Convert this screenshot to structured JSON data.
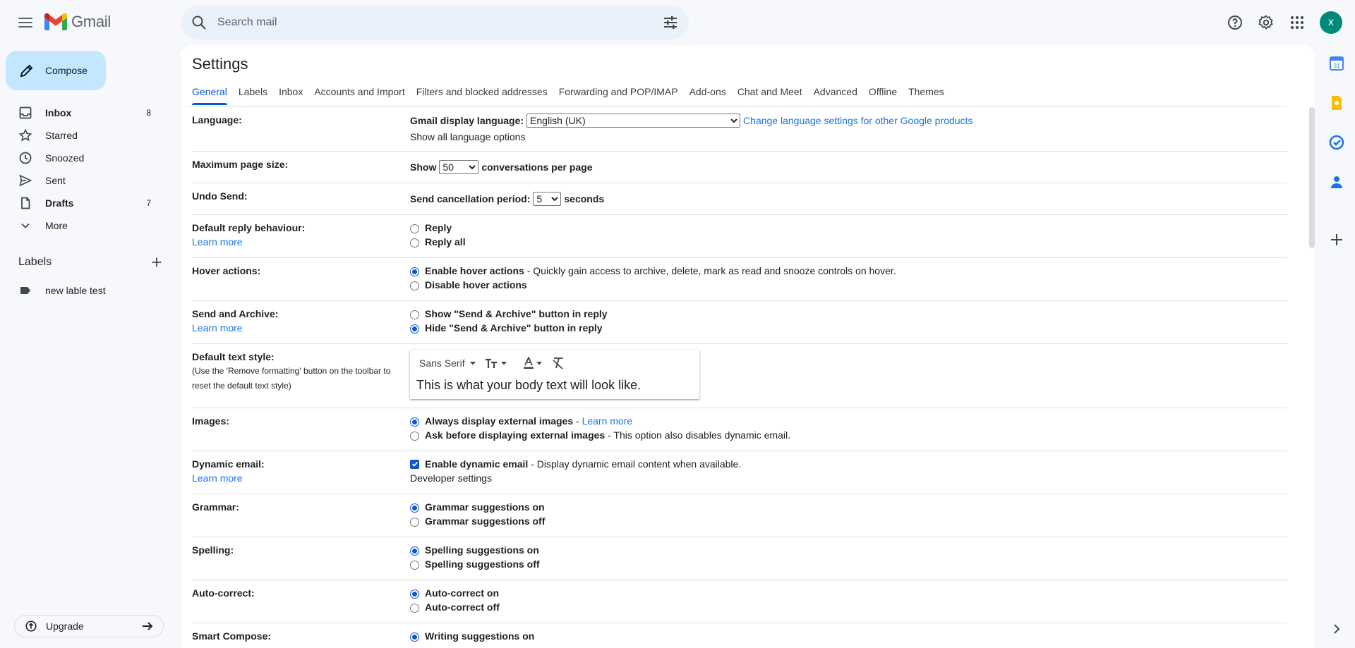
{
  "app": {
    "name": "Gmail"
  },
  "search": {
    "placeholder": "Search mail"
  },
  "user": {
    "initial": "x"
  },
  "compose_label": "Compose",
  "nav": [
    {
      "label": "Inbox",
      "count": "8",
      "bold": true,
      "icon": "inbox-icon"
    },
    {
      "label": "Starred",
      "count": "",
      "bold": false,
      "icon": "star-icon"
    },
    {
      "label": "Snoozed",
      "count": "",
      "bold": false,
      "icon": "clock-icon"
    },
    {
      "label": "Sent",
      "count": "",
      "bold": false,
      "icon": "send-icon"
    },
    {
      "label": "Drafts",
      "count": "7",
      "bold": true,
      "icon": "draft-icon"
    },
    {
      "label": "More",
      "count": "",
      "bold": false,
      "icon": "chevron-down-icon"
    }
  ],
  "labels": {
    "heading": "Labels",
    "items": [
      "new lable test"
    ]
  },
  "upgrade_label": "Upgrade",
  "settings": {
    "title": "Settings",
    "tabs": [
      "General",
      "Labels",
      "Inbox",
      "Accounts and Import",
      "Filters and blocked addresses",
      "Forwarding and POP/IMAP",
      "Add-ons",
      "Chat and Meet",
      "Advanced",
      "Offline",
      "Themes"
    ],
    "active_tab": "General",
    "language": {
      "label": "Language:",
      "display_label": "Gmail display language:",
      "selected": "English (UK)",
      "change_link": "Change language settings for other Google products",
      "show_all": "Show all language options"
    },
    "page_size": {
      "label": "Maximum page size:",
      "prefix": "Show",
      "selected": "50",
      "suffix": "conversations per page"
    },
    "undo_send": {
      "label": "Undo Send:",
      "prefix": "Send cancellation period:",
      "selected": "5",
      "suffix": "seconds"
    },
    "reply": {
      "label": "Default reply behaviour:",
      "learn_more": "Learn more",
      "options": [
        "Reply",
        "Reply all"
      ],
      "selected": -1
    },
    "hover": {
      "label": "Hover actions:",
      "options": [
        "Enable hover actions",
        "Disable hover actions"
      ],
      "desc": "- Quickly gain access to archive, delete, mark as read and snooze controls on hover.",
      "selected": 0
    },
    "send_archive": {
      "label": "Send and Archive:",
      "learn_more": "Learn more",
      "options": [
        "Show \"Send & Archive\" button in reply",
        "Hide \"Send & Archive\" button in reply"
      ],
      "selected": 1
    },
    "text_style": {
      "label": "Default text style:",
      "note": "(Use the 'Remove formatting' button on the toolbar to reset the default text style)",
      "font": "Sans Serif",
      "sample": "This is what your body text will look like."
    },
    "images": {
      "label": "Images:",
      "options": [
        "Always display external images",
        "Ask before displaying external images"
      ],
      "learn_more": "Learn more",
      "desc": "- This option also disables dynamic email.",
      "selected": 0
    },
    "dynamic": {
      "label": "Dynamic email:",
      "learn_more": "Learn more",
      "check_label": "Enable dynamic email",
      "desc": "- Display dynamic email content when available.",
      "dev": "Developer settings",
      "checked": true
    },
    "grammar": {
      "label": "Grammar:",
      "options": [
        "Grammar suggestions on",
        "Grammar suggestions off"
      ],
      "selected": 0
    },
    "spelling": {
      "label": "Spelling:",
      "options": [
        "Spelling suggestions on",
        "Spelling suggestions off"
      ],
      "selected": 0
    },
    "autocorrect": {
      "label": "Auto-correct:",
      "options": [
        "Auto-correct on",
        "Auto-correct off"
      ],
      "selected": 0
    },
    "smart_compose": {
      "label": "Smart Compose:",
      "options": [
        "Writing suggestions on"
      ],
      "selected": 0
    }
  },
  "colors": {
    "accent": "#0b57d0",
    "compose_bg": "#c2e7ff",
    "avatar_bg": "#00897b",
    "link": "#1a73e8"
  }
}
